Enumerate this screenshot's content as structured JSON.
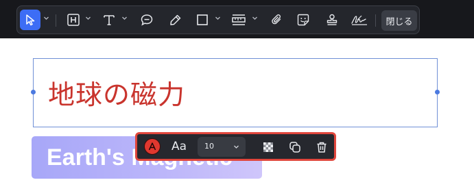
{
  "toolbar": {
    "tools": [
      {
        "name": "select-tool",
        "icon": "cursor-arrow-icon",
        "active": true,
        "has_dropdown": true
      },
      {
        "name": "heading-tool",
        "icon": "heading-box-icon",
        "has_dropdown": true
      },
      {
        "name": "text-tool",
        "icon": "text-t-icon",
        "has_dropdown": true
      },
      {
        "name": "comment-tool",
        "icon": "speech-bubble-icon"
      },
      {
        "name": "highlight-tool",
        "icon": "pencil-icon"
      },
      {
        "name": "shape-tool",
        "icon": "rectangle-icon",
        "has_dropdown": true
      },
      {
        "name": "measure-tool",
        "icon": "ruler-icon",
        "has_dropdown": true
      },
      {
        "name": "attach-tool",
        "icon": "paperclip-icon"
      },
      {
        "name": "sticker-tool",
        "icon": "sticker-face-icon"
      },
      {
        "name": "stamp-tool",
        "icon": "stamp-icon"
      },
      {
        "name": "signature-tool",
        "icon": "signature-icon"
      }
    ],
    "close_label": "閉じる",
    "accent_color": "#3d6df5"
  },
  "canvas": {
    "title_text": "地球の磁力",
    "title_color": "#c9342d",
    "heading_text": "Earth's Magnetic"
  },
  "format_bar": {
    "text_color": "#e0382f",
    "font_button_label": "Aa",
    "font_size_value": "10",
    "border_color": "#e0463c"
  }
}
